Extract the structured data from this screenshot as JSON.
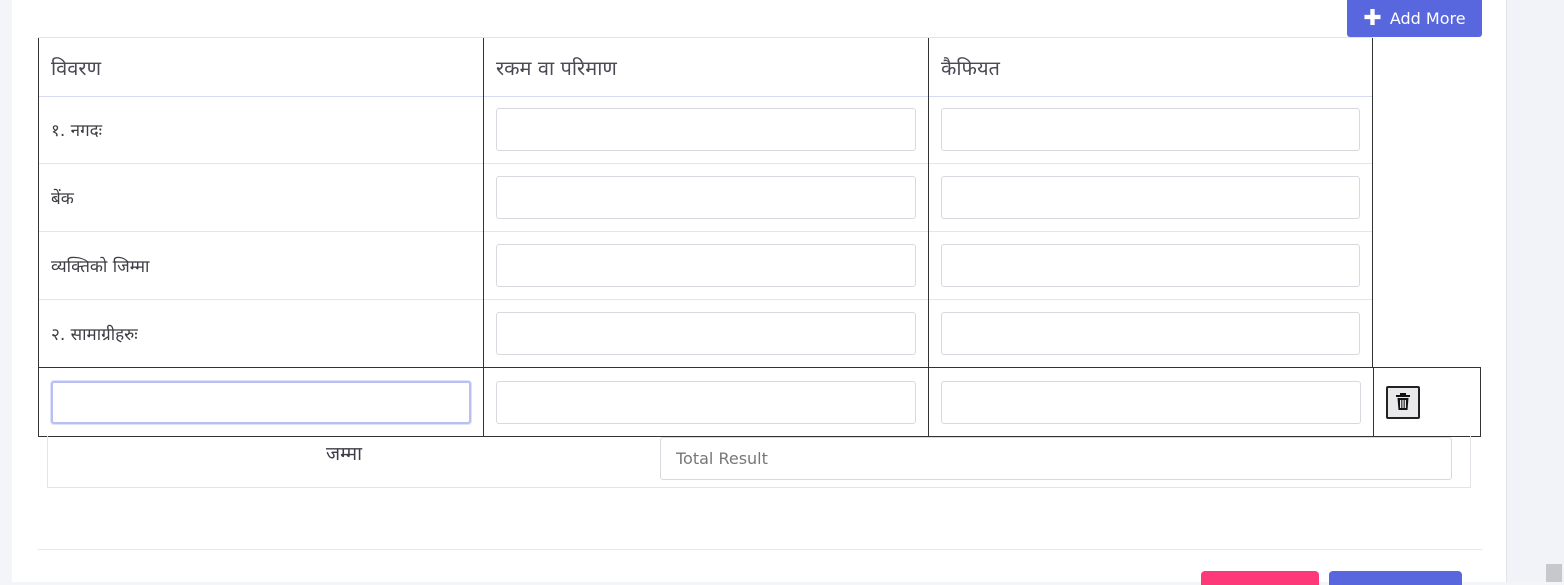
{
  "toolbar": {
    "add_more_label": "Add More"
  },
  "table": {
    "headers": [
      "विवरण",
      "रकम वा परिमाण",
      "कैफियत"
    ],
    "rows": [
      {
        "label": "१. नगदः"
      },
      {
        "label": "बेंक"
      },
      {
        "label": "व्यक्तिको जिम्मा"
      },
      {
        "label": "२. सामाग्रीहरुः"
      }
    ]
  },
  "total": {
    "label": "जम्मा",
    "placeholder": "Total Result"
  },
  "colors": {
    "primary": "#5867dd",
    "danger": "#fd397a"
  },
  "icons": {
    "add": "plus-icon",
    "delete": "trash-icon"
  }
}
